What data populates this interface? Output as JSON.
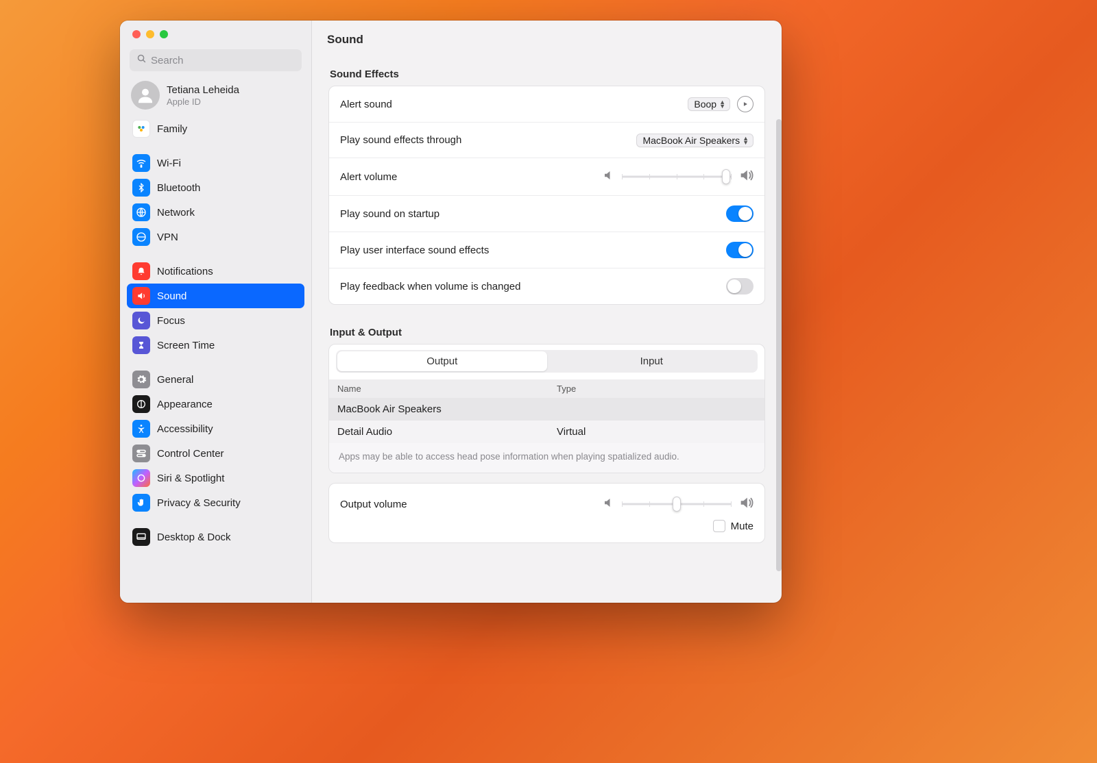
{
  "window": {
    "title": "Sound"
  },
  "search": {
    "placeholder": "Search"
  },
  "account": {
    "name": "Tetiana Leheida",
    "sub": "Apple ID"
  },
  "sidebar": {
    "items": [
      {
        "label": "Family",
        "icon": "family-icon",
        "bg": "#ffffff",
        "fg": "#ffb800"
      },
      {
        "label": "Wi-Fi",
        "icon": "wifi-icon",
        "bg": "#0a84ff"
      },
      {
        "label": "Bluetooth",
        "icon": "bluetooth-icon",
        "bg": "#0a84ff"
      },
      {
        "label": "Network",
        "icon": "globe-icon",
        "bg": "#0a84ff"
      },
      {
        "label": "VPN",
        "icon": "vpn-icon",
        "bg": "#0a84ff"
      },
      {
        "label": "Notifications",
        "icon": "bell-icon",
        "bg": "#ff3b30"
      },
      {
        "label": "Sound",
        "icon": "speaker-icon",
        "bg": "#ff3b30",
        "selected": true
      },
      {
        "label": "Focus",
        "icon": "moon-icon",
        "bg": "#5856d6"
      },
      {
        "label": "Screen Time",
        "icon": "hourglass-icon",
        "bg": "#5856d6"
      },
      {
        "label": "General",
        "icon": "gear-icon",
        "bg": "#8e8d92"
      },
      {
        "label": "Appearance",
        "icon": "appearance-icon",
        "bg": "#1a1a1a"
      },
      {
        "label": "Accessibility",
        "icon": "accessibility-icon",
        "bg": "#0a84ff"
      },
      {
        "label": "Control Center",
        "icon": "switches-icon",
        "bg": "#8e8d92"
      },
      {
        "label": "Siri & Spotlight",
        "icon": "siri-icon",
        "bg": "#1a1a1a"
      },
      {
        "label": "Privacy & Security",
        "icon": "hand-icon",
        "bg": "#0a84ff"
      },
      {
        "label": "Desktop & Dock",
        "icon": "dock-icon",
        "bg": "#1a1a1a"
      }
    ]
  },
  "sections": {
    "effects_title": "Sound Effects",
    "io_title": "Input & Output"
  },
  "effects": {
    "alert_sound_label": "Alert sound",
    "alert_sound_value": "Boop",
    "play_through_label": "Play sound effects through",
    "play_through_value": "MacBook Air Speakers",
    "alert_volume_label": "Alert volume",
    "alert_volume_percent": 95,
    "startup_label": "Play sound on startup",
    "startup_on": true,
    "ui_sounds_label": "Play user interface sound effects",
    "ui_sounds_on": true,
    "feedback_label": "Play feedback when volume is changed",
    "feedback_on": false
  },
  "io": {
    "tabs": {
      "output": "Output",
      "input": "Input",
      "active": "output"
    },
    "columns": {
      "name": "Name",
      "type": "Type"
    },
    "devices": [
      {
        "name": "MacBook Air Speakers",
        "type": "",
        "selected": true
      },
      {
        "name": "Detail Audio",
        "type": "Virtual",
        "selected": false
      }
    ],
    "note": "Apps may be able to access head pose information when playing spatialized audio."
  },
  "output_volume": {
    "label": "Output volume",
    "percent": 50,
    "mute_label": "Mute",
    "mute_checked": false
  }
}
